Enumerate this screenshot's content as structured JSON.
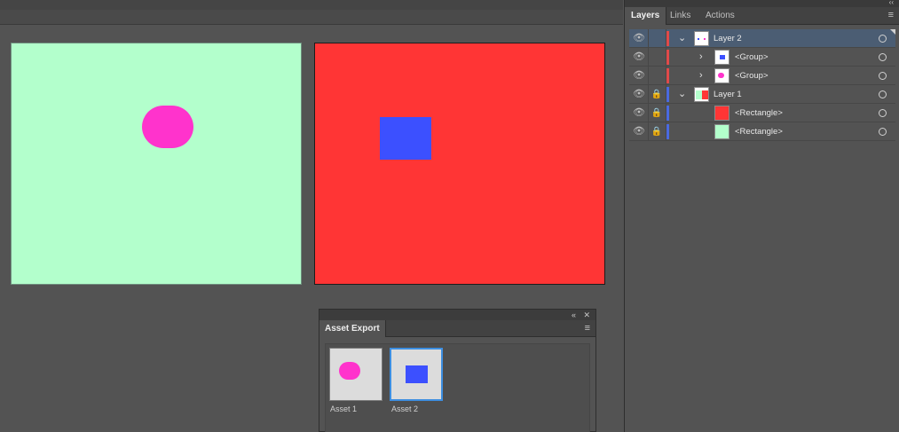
{
  "colors": {
    "mint": "#b3ffcc",
    "red": "#ff3535",
    "magenta": "#ff33cc",
    "blue": "#3c50ff",
    "layer2_color": "#e04a4a",
    "layer1_color": "#4a6ae0"
  },
  "canvas": {
    "artboards": [
      {
        "fill": "#b3ffcc",
        "shape": "pill",
        "shape_color": "#ff33cc"
      },
      {
        "fill": "#ff3535",
        "shape": "rectangle",
        "shape_color": "#3c50ff"
      }
    ]
  },
  "asset_export": {
    "collapse_icon": "«",
    "close_icon": "✕",
    "tab_label": "Asset Export",
    "menu_icon": "≡",
    "assets": [
      {
        "label": "Asset 1",
        "shape_color": "#ff33cc",
        "selected": false
      },
      {
        "label": "Asset 2",
        "shape_color": "#3c50ff",
        "selected": true
      }
    ]
  },
  "layers_panel": {
    "collapse_icon": "‹‹",
    "tabs": [
      "Layers",
      "Links",
      "Actions"
    ],
    "active_tab": "Layers",
    "menu_icon": "≡",
    "eye_icon": "👁",
    "lock_icon": "🔒",
    "expand_icon": "⌄",
    "collapsed_icon": "›",
    "rows": [
      {
        "name": "Layer 2",
        "level": 0,
        "expanded": true,
        "locked": false,
        "selected": true
      },
      {
        "name": "<Group>",
        "level": 1,
        "expanded": false,
        "locked": false,
        "selected": false
      },
      {
        "name": "<Group>",
        "level": 1,
        "expanded": false,
        "locked": false,
        "selected": false
      },
      {
        "name": "Layer 1",
        "level": 0,
        "expanded": true,
        "locked": true,
        "selected": false
      },
      {
        "name": "<Rectangle>",
        "level": 1,
        "expanded": false,
        "locked": true,
        "selected": false
      },
      {
        "name": "<Rectangle>",
        "level": 1,
        "expanded": false,
        "locked": true,
        "selected": false
      }
    ]
  }
}
